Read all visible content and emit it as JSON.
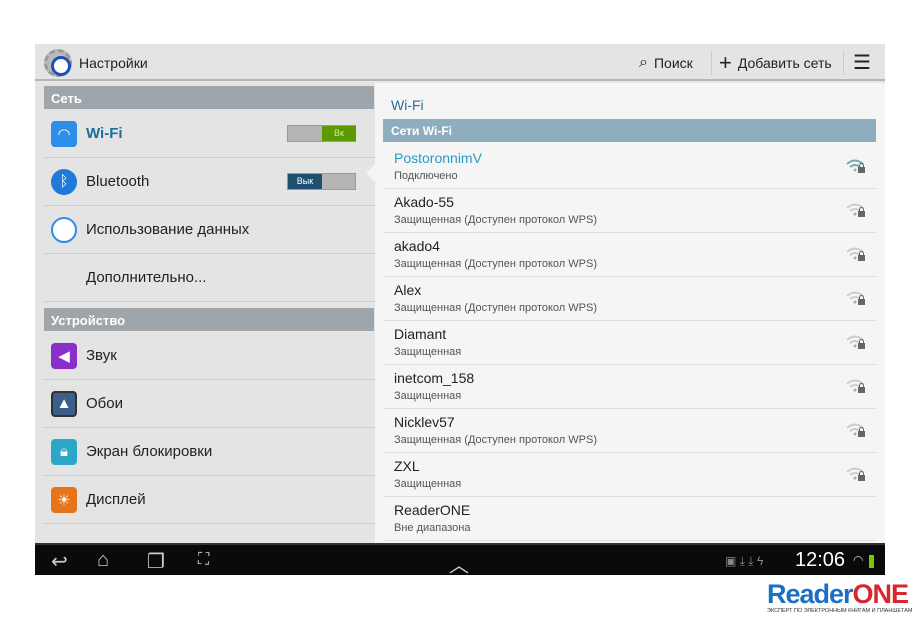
{
  "actionbar": {
    "title": "Настройки",
    "search": "Поиск",
    "add_network": "Добавить сеть"
  },
  "left": {
    "sections": [
      "Сеть",
      "Устройство"
    ],
    "items": [
      {
        "label": "Wi-Fi",
        "icon": "wifi-icon",
        "toggle": "Вк",
        "state": "on"
      },
      {
        "label": "Bluetooth",
        "icon": "bluetooth-icon",
        "toggle": "Вык",
        "state": "off"
      },
      {
        "label": "Использование данных",
        "icon": "data-usage-icon"
      },
      {
        "label": "Дополнительно..."
      },
      {
        "label": "Звук",
        "icon": "sound-icon"
      },
      {
        "label": "Обои",
        "icon": "wallpaper-icon"
      },
      {
        "label": "Экран блокировки",
        "icon": "lock-screen-icon"
      },
      {
        "label": "Дисплей",
        "icon": "display-icon"
      }
    ]
  },
  "right": {
    "title": "Wi-Fi",
    "header": "Сети Wi-Fi",
    "networks": [
      {
        "name": "PostoronnimV",
        "status": "Подключено"
      },
      {
        "name": "Akado-55",
        "status": "Защищенная (Доступен протокол WPS)"
      },
      {
        "name": "akado4",
        "status": "Защищенная (Доступен протокол WPS)"
      },
      {
        "name": "Alex",
        "status": "Защищенная (Доступен протокол WPS)"
      },
      {
        "name": "Diamant",
        "status": "Защищенная"
      },
      {
        "name": "inetcom_158",
        "status": "Защищенная"
      },
      {
        "name": "Nicklev57",
        "status": "Защищенная (Доступен протокол WPS)"
      },
      {
        "name": "ZXL",
        "status": "Защищенная"
      },
      {
        "name": "ReaderONE",
        "status": "Вне диапазона"
      }
    ]
  },
  "statusbar": {
    "time": "12:06"
  },
  "watermark": {
    "brand": "ReaderONE",
    "tagline": "ЭКСПЕРТ ПО ЭЛЕКТРОННЫМ КНИГАМ И ПЛАНШЕТАМ"
  },
  "colors": {
    "accent": "#2a9ac9",
    "on": "#5c9a00",
    "off": "#1f4f6e"
  }
}
